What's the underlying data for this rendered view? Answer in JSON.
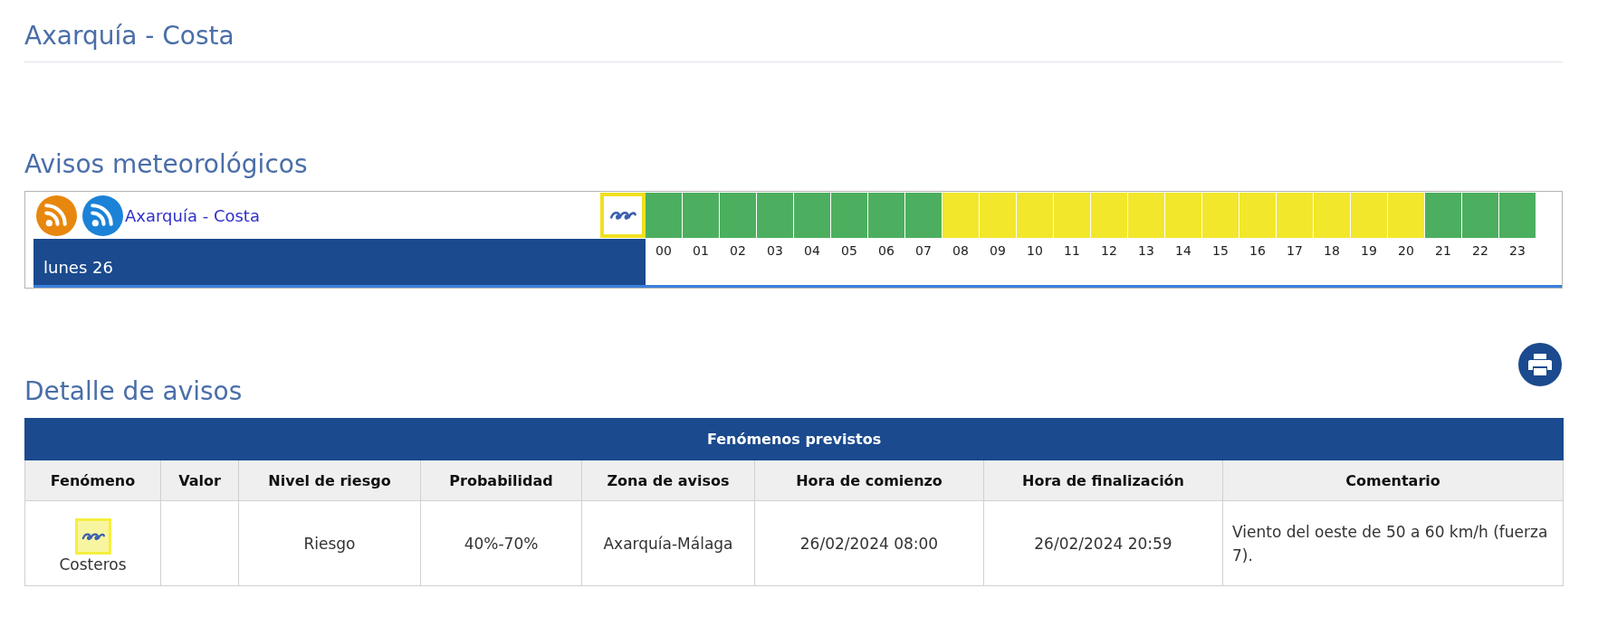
{
  "page_title": "Axarquía - Costa",
  "warnings": {
    "heading": "Avisos meteorológicos",
    "zone_link": "Axarquía - Costa",
    "day": "lunes 26",
    "hours": [
      {
        "label": "00",
        "color": "#4caf5f"
      },
      {
        "label": "01",
        "color": "#4caf5f"
      },
      {
        "label": "02",
        "color": "#4caf5f"
      },
      {
        "label": "03",
        "color": "#4caf5f"
      },
      {
        "label": "04",
        "color": "#4caf5f"
      },
      {
        "label": "05",
        "color": "#4caf5f"
      },
      {
        "label": "06",
        "color": "#4caf5f"
      },
      {
        "label": "07",
        "color": "#4caf5f"
      },
      {
        "label": "08",
        "color": "#f3e72b"
      },
      {
        "label": "09",
        "color": "#f3e72b"
      },
      {
        "label": "10",
        "color": "#f3e72b"
      },
      {
        "label": "11",
        "color": "#f3e72b"
      },
      {
        "label": "12",
        "color": "#f3e72b"
      },
      {
        "label": "13",
        "color": "#f3e72b"
      },
      {
        "label": "14",
        "color": "#f3e72b"
      },
      {
        "label": "15",
        "color": "#f3e72b"
      },
      {
        "label": "16",
        "color": "#f3e72b"
      },
      {
        "label": "17",
        "color": "#f3e72b"
      },
      {
        "label": "18",
        "color": "#f3e72b"
      },
      {
        "label": "19",
        "color": "#f3e72b"
      },
      {
        "label": "20",
        "color": "#f3e72b"
      },
      {
        "label": "21",
        "color": "#4caf5f"
      },
      {
        "label": "22",
        "color": "#4caf5f"
      },
      {
        "label": "23",
        "color": "#4caf5f"
      }
    ]
  },
  "details": {
    "heading": "Detalle de avisos",
    "table": {
      "caption": "Fenómenos previstos",
      "columns": [
        "Fenómeno",
        "Valor",
        "Nivel de riesgo",
        "Probabilidad",
        "Zona de avisos",
        "Hora de comienzo",
        "Hora de finalización",
        "Comentario"
      ],
      "rows": [
        {
          "phenomenon": "Costeros",
          "risk_level": "Riesgo",
          "probability": "40%-70%",
          "zone": "Axarquía-Málaga",
          "start": "26/02/2024 08:00",
          "end": "26/02/2024 20:59",
          "comment": "Viento del oeste de 50 a 60 km/h (fuerza 7)."
        }
      ]
    }
  }
}
